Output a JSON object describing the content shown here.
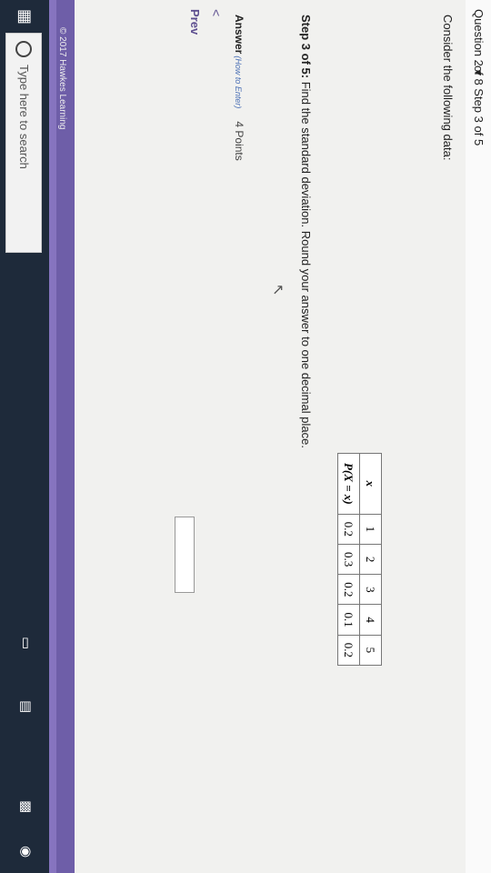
{
  "header": {
    "question_label": "Question 2 ▾",
    "progress_label": "of 8 Step 3 of 5"
  },
  "problem": {
    "intro": "Consider the following data:",
    "step_label": "Step 3 of 5:",
    "step_text": " Find the standard deviation. Round your answer to one decimal place."
  },
  "table": {
    "row1_label": "x",
    "row2_label": "P(X = x)",
    "x_values": [
      "1",
      "2",
      "3",
      "4",
      "5"
    ],
    "p_values": [
      "0.2",
      "0.3",
      "0.2",
      "0.1",
      "0.2"
    ]
  },
  "answer": {
    "label": "Answer",
    "how_to": "(How to Enter)",
    "points": "4 Points",
    "value": ""
  },
  "nav": {
    "back_glyph": "<",
    "prev_label": "Prev"
  },
  "footer": {
    "copyright": "© 2017 Hawkes Learning"
  },
  "taskbar": {
    "search_placeholder": "Type here to search"
  },
  "colors": {
    "accent": "#6e5ea8",
    "taskbar": "#1e2a3a"
  }
}
